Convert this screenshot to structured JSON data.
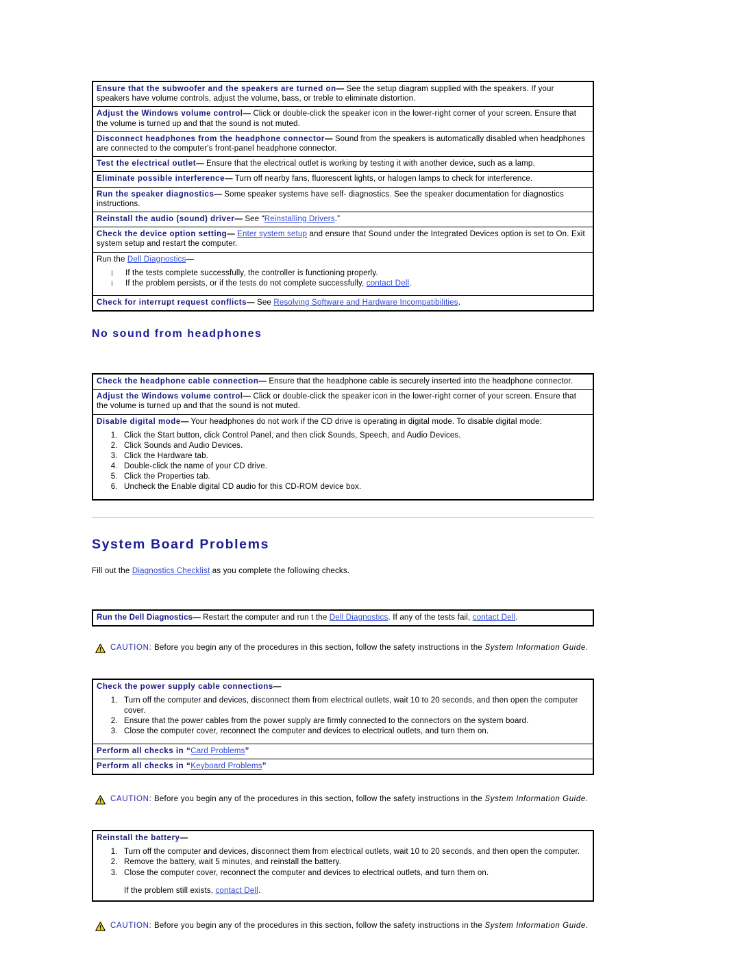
{
  "speaker_table": {
    "rows": [
      {
        "term": "Ensure that the subwoofer and the speakers are turned on",
        "dash": "—",
        "text": " See the setup diagram supplied with the speakers. If your speakers have volume controls, adjust the volume, bass, or treble to eliminate distortion."
      },
      {
        "term": "Adjust the Windows volume control",
        "dash": "—",
        "text": " Click or double-click the speaker icon in the lower-right corner of your screen. Ensure that the volume is turned up and that the sound is not muted."
      },
      {
        "term": "Disconnect headphones from the headphone connector",
        "dash": "—",
        "text": " Sound from the speakers is automatically disabled when headphones are connected to the computer's front-panel headphone connector."
      },
      {
        "term": "Test the electrical outlet",
        "dash": "—",
        "text": " Ensure that the electrical outlet is working by testing it with another device, such as a lamp."
      },
      {
        "term": "Eliminate possible interference",
        "dash": "—",
        "text": " Turn off nearby fans, fluorescent lights, or halogen lamps to check for interference."
      },
      {
        "term": "Run the speaker diagnostics",
        "dash": "—",
        "text": " Some speaker systems have self- diagnostics. See the speaker documentation for diagnostics instructions."
      }
    ],
    "reinstall_audio": {
      "term": "Reinstall the audio (sound) driver",
      "dash": "—",
      "pre": " See “",
      "link": "Reinstalling Drivers",
      "post": ".”"
    },
    "device_option": {
      "term": "Check the device option setting",
      "dash": "—",
      "pre": " ",
      "link": "Enter system setup",
      "post": " and ensure that Sound under the Integrated Devices option is set to On. Exit system setup and restart the computer."
    },
    "run_diagnostics": {
      "pre": "Run the ",
      "link": "Dell Diagnostics",
      "dash": "—",
      "bullets": [
        {
          "text": "If the tests complete successfully, the controller is functioning properly.",
          "link": "",
          "post": ""
        },
        {
          "text": "If the problem persists, or if the tests do not complete successfully, ",
          "link": "contact Dell",
          "post": "."
        }
      ]
    },
    "interrupt_row": {
      "term": "Check for interrupt request conflicts",
      "dash": "—",
      "pre": " See ",
      "link": "Resolving Software and Hardware Incompatibilities",
      "post": "."
    }
  },
  "headphones": {
    "heading": "No sound from headphones",
    "rows": [
      {
        "term": "Check the headphone cable connection",
        "dash": "—",
        "text": " Ensure that the headphone cable is securely inserted into the headphone connector."
      },
      {
        "term": "Adjust the Windows volume control",
        "dash": "—",
        "text": " Click or double-click the speaker icon in the lower-right corner of your screen. Ensure that the volume is turned up and that the sound is not muted."
      }
    ],
    "disable_digital": {
      "term": "Disable digital mode",
      "dash": "—",
      "text": " Your headphones do not work if the CD drive is operating in digital mode. To disable digital mode:",
      "steps": [
        "Click the Start button, click Control Panel, and then click Sounds, Speech, and Audio Devices.",
        "Click Sounds and Audio Devices.",
        "Click the Hardware tab.",
        "Double-click the name of your CD drive.",
        "Click the Properties tab.",
        "Uncheck the Enable digital CD audio for this CD-ROM device box."
      ]
    }
  },
  "system_board": {
    "heading": "System Board Problems",
    "intro": {
      "pre": "Fill out the ",
      "link": "Diagnostics Checklist",
      "post": " as you complete the following checks."
    },
    "run_diagnostics_row": {
      "term": "Run the Dell Diagnostics",
      "dash": "—",
      "pre": " Restart the computer and run t the ",
      "link1": "Dell Diagnostics",
      "mid": ". If any of the tests fail, ",
      "link2": "contact Dell",
      "post": "."
    },
    "power_supply": {
      "term": "Check the power supply cable connections",
      "dash": "—",
      "steps": [
        "Turn off the computer and devices, disconnect them from electrical outlets, wait 10 to 20 seconds, and then open the computer cover.",
        "Ensure that the power cables from the power supply are firmly connected to the connectors on the system board.",
        "Close the computer cover, reconnect the computer and devices to electrical outlets, and turn them on."
      ]
    },
    "card_problems": {
      "pre": "Perform all checks in “",
      "link": "Card Problems",
      "post": "”"
    },
    "keyboard_problems": {
      "pre": "Perform all checks in “",
      "link": "Keyboard Problems",
      "post": "”"
    },
    "reinstall_battery": {
      "term": "Reinstall the battery",
      "dash": "—",
      "steps": [
        "Turn off the computer and devices, disconnect them from electrical outlets, wait 10 to 20 seconds, and then open the computer.",
        "Remove the battery, wait 5 minutes, and reinstall the battery.",
        "Close the computer cover, reconnect the computer and devices to electrical outlets, and turn them on."
      ],
      "note_pre": "If the problem still exists, ",
      "note_link": "contact Dell",
      "note_post": "."
    }
  },
  "caution": {
    "title": "CAUTION:",
    "text": " Before you begin any of the procedures in this section, follow the safety instructions in the ",
    "guide": "System Information Guide",
    "end": "."
  },
  "colors": {
    "heading_blue": "#1c1c96",
    "term_blue": "#18187c",
    "link_blue": "#2d45d8",
    "caution_blue": "#2a2ab0",
    "caution_triangle": "#f2d417",
    "rule_gray": "#c4c4c4",
    "table_border": "#000000"
  }
}
